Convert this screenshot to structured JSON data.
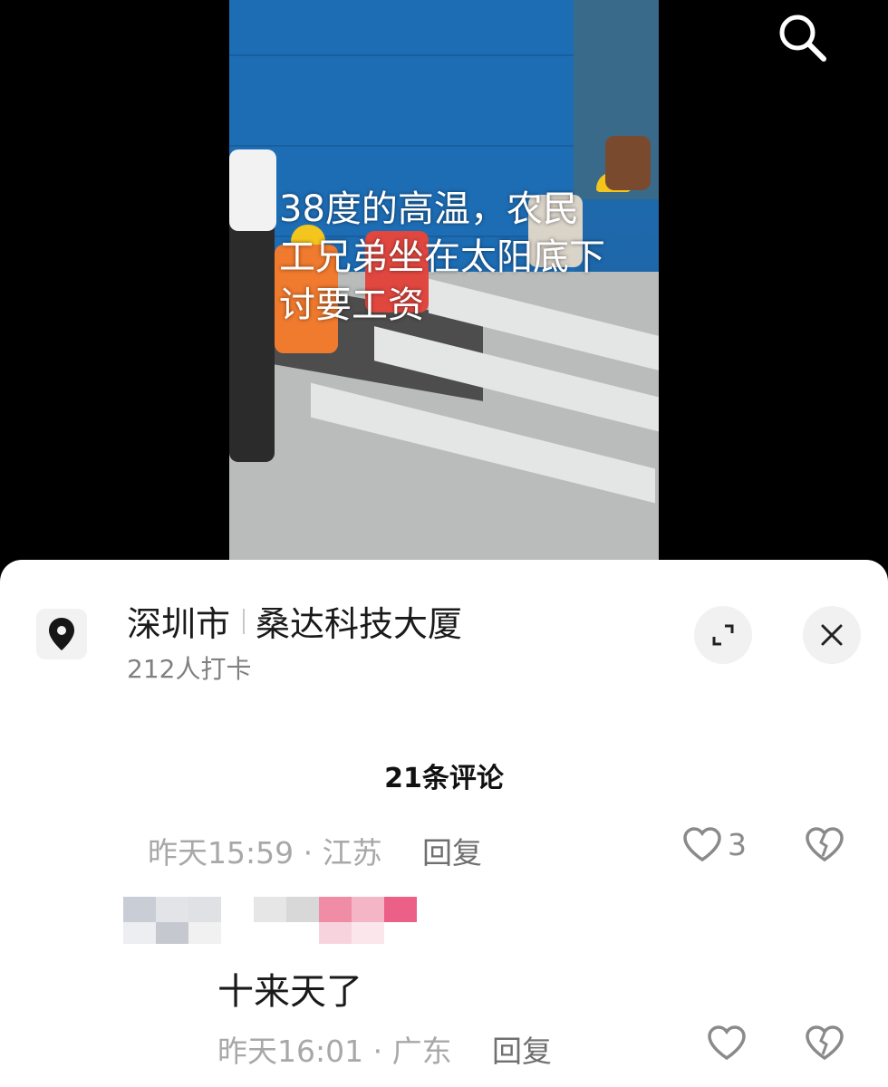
{
  "video": {
    "caption": "38度的高温，农民工兄弟坐在太阳底下讨要工资"
  },
  "toolbar": {
    "search_icon": "search-icon"
  },
  "location": {
    "city": "深圳市",
    "place": "桑达科技大厦",
    "checkins": "212人打卡"
  },
  "comments_header": "21条评论",
  "comments": [
    {
      "meta": "昨天15:59 · 江苏",
      "reply_label": "回复",
      "likes": "3"
    },
    {
      "text": "十来天了",
      "meta": "昨天16:01 · 广东",
      "reply_label": "回复",
      "likes": ""
    }
  ],
  "colors": {
    "accent_wall": "#1d6db5",
    "sheet_bg": "#ffffff",
    "meta_text": "#a8a8a8"
  }
}
